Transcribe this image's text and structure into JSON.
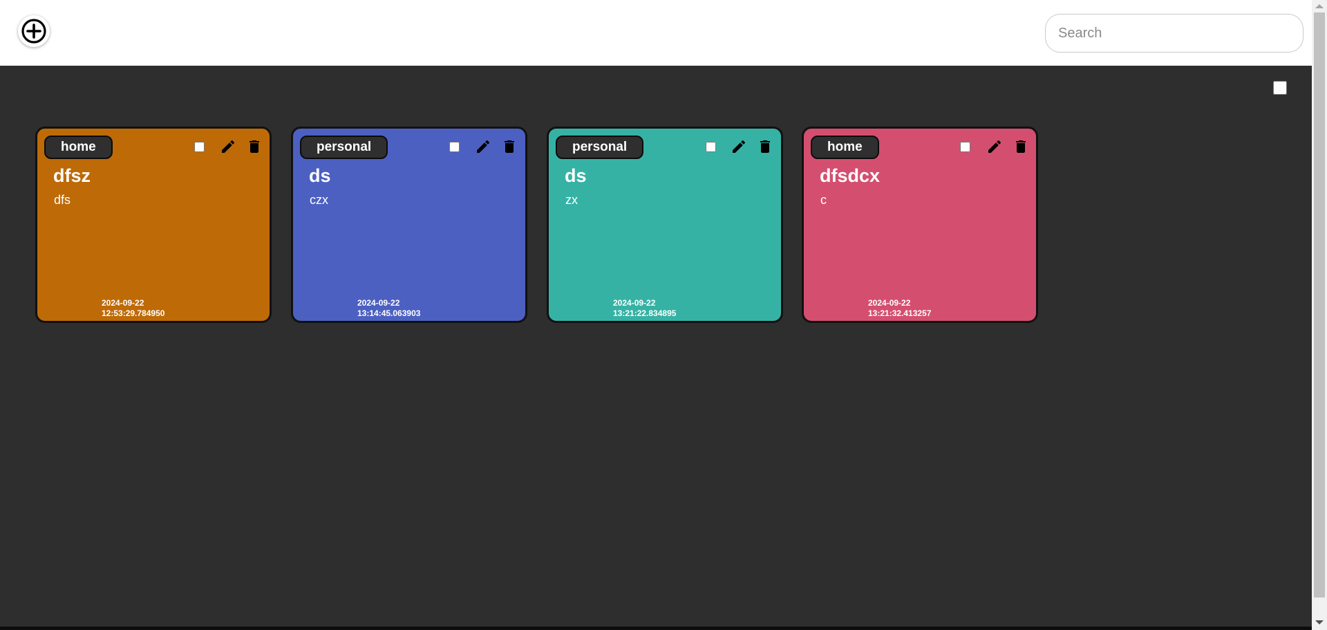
{
  "toolbar": {
    "add_icon": "plus-circle-icon",
    "search_placeholder": "Search"
  },
  "notes": [
    {
      "tag": "home",
      "title": "dfsz",
      "description": "dfs",
      "date": "2024-09-22",
      "time": "12:53:29.784950",
      "color": "#be6a07"
    },
    {
      "tag": "personal",
      "title": "ds",
      "description": "czx",
      "date": "2024-09-22",
      "time": "13:14:45.063903",
      "color": "#4c60c1"
    },
    {
      "tag": "personal",
      "title": "ds",
      "description": "zx",
      "date": "2024-09-22",
      "time": "13:21:22.834895",
      "color": "#36b2a5"
    },
    {
      "tag": "home",
      "title": "dfsdcx",
      "description": "c",
      "date": "2024-09-22",
      "time": "13:21:32.413257",
      "color": "#d44f6f"
    }
  ],
  "colors": {
    "background": "#2e2e2e",
    "topbar": "#ffffff",
    "tag_background": "#2f2f2f"
  }
}
